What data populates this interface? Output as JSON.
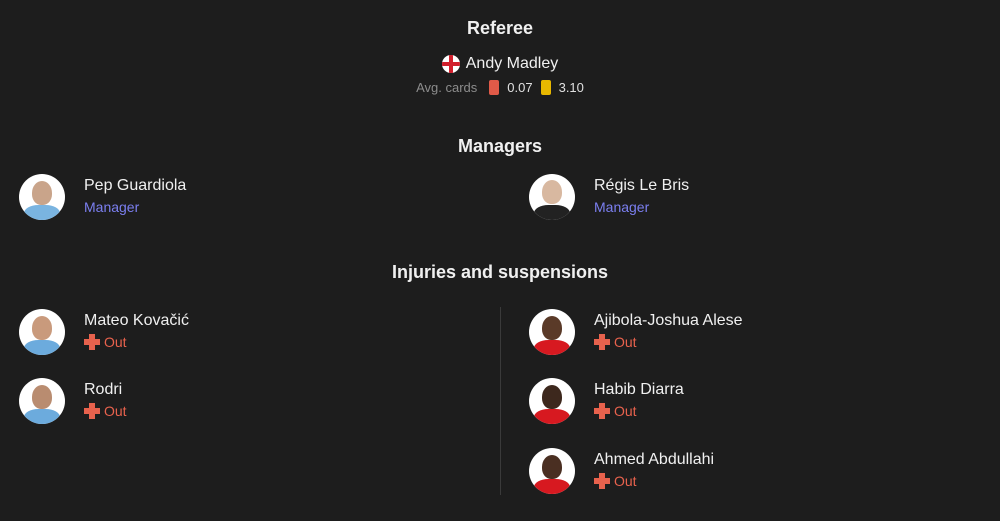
{
  "referee": {
    "section_title": "Referee",
    "name": "Andy Madley",
    "flag_icon": "england-flag-icon",
    "avg_cards_label": "Avg. cards",
    "red_cards_avg": "0.07",
    "yellow_cards_avg": "3.10"
  },
  "managers": {
    "section_title": "Managers",
    "home": {
      "name": "Pep Guardiola",
      "role": "Manager"
    },
    "away": {
      "name": "Régis Le Bris",
      "role": "Manager"
    }
  },
  "injuries": {
    "section_title": "Injuries and suspensions",
    "home": [
      {
        "name": "Mateo Kovačić",
        "status": "Out"
      },
      {
        "name": "Rodri",
        "status": "Out"
      }
    ],
    "away": [
      {
        "name": "Ajibola-Joshua Alese",
        "status": "Out"
      },
      {
        "name": "Habib Diarra",
        "status": "Out"
      },
      {
        "name": "Ahmed Abdullahi",
        "status": "Out"
      }
    ]
  },
  "colors": {
    "background": "#1d1d1d",
    "manager_role": "#7b7ff0",
    "status_out": "#e8624d",
    "red_card": "#e05a48",
    "yellow_card": "#e8b800",
    "home_kit": "#6cabdd",
    "away_kit": "#d71920"
  }
}
